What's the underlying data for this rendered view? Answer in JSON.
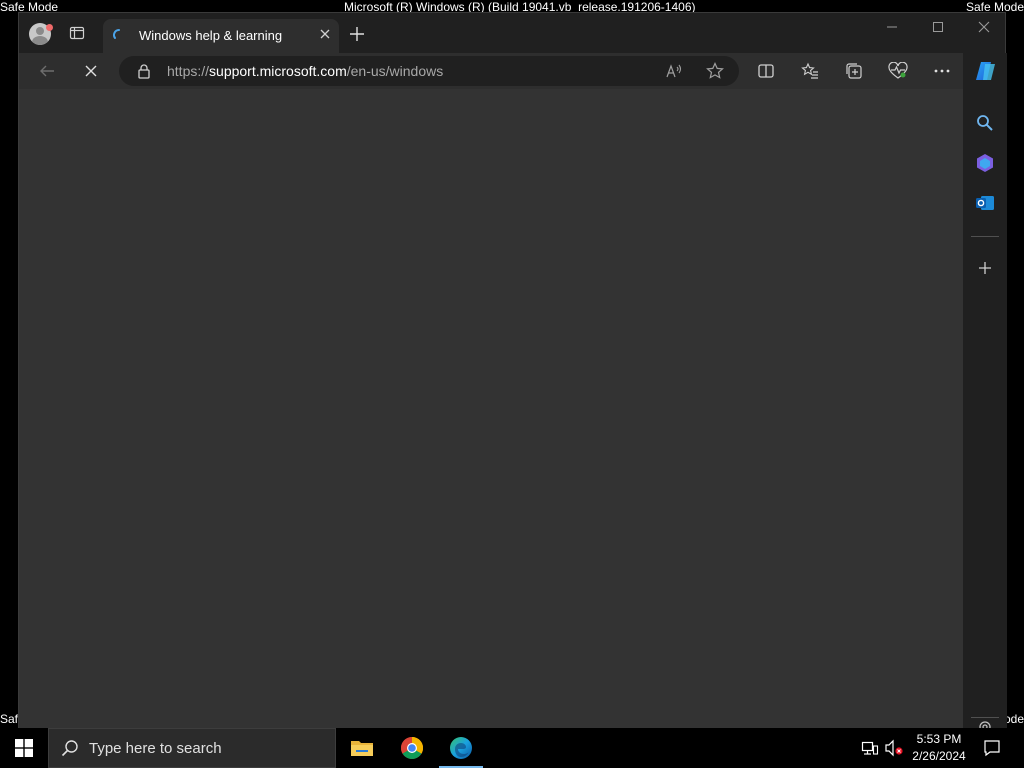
{
  "overlay": {
    "safe_mode_label": "Safe Mode",
    "build_title": "Microsoft (R) Windows (R) (Build 19041.vb_release.191206-1406)",
    "safe_mode_bl": "Safe Mode",
    "safe_mode_br": "Safe Mode"
  },
  "browser": {
    "tab_title": "Windows help & learning",
    "url_scheme": "https://",
    "url_host": "support.microsoft.com",
    "url_path": "/en-us/windows",
    "loading": true
  },
  "taskbar": {
    "search_placeholder": "Type here to search",
    "time": "5:53 PM",
    "date": "2/26/2024",
    "pinned": [
      "file-explorer-icon",
      "chrome-icon",
      "edge-icon"
    ]
  },
  "colors": {
    "content_bg": "#333333",
    "chrome_bg": "#202020",
    "toolbar_bg": "#2e2e2e",
    "accent": "#76b9ed"
  }
}
